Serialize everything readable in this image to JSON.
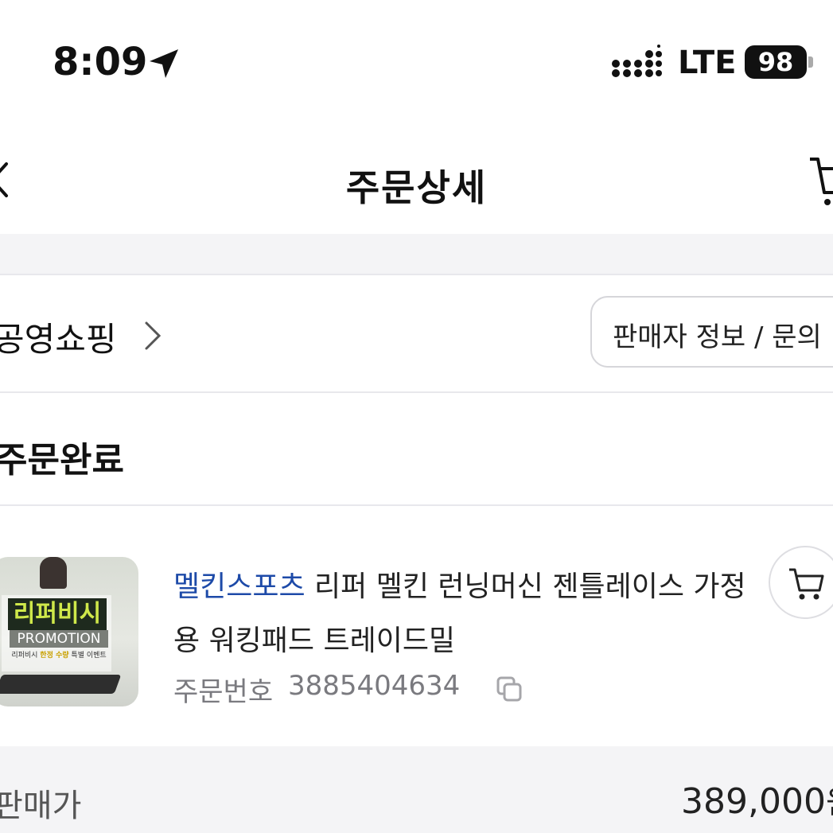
{
  "status_bar": {
    "time": "8:09",
    "network": "LTE",
    "battery": "98"
  },
  "header": {
    "title": "주문상세"
  },
  "seller": {
    "name": "공영쇼핑",
    "info_button": "판매자 정보 / 문의"
  },
  "order": {
    "status": "주문완료",
    "product": {
      "brand": "멜킨스포츠",
      "name": " 리퍼 멜킨 런닝머신 젠틀레이스 가정용 워킹패드 트레이드밀",
      "thumbnail": {
        "title": "리퍼비시",
        "promo": "PROMOTION",
        "sub_prefix": "리퍼비시 ",
        "sub_highlight": "한정 수량",
        "sub_suffix": " 특별 이벤트"
      }
    },
    "order_number_label": "주문번호",
    "order_number": "3885404634"
  },
  "price": {
    "label": "판매가",
    "value": "389,000",
    "unit": "원"
  },
  "icons": {
    "back": "chevron-left-icon",
    "cart": "cart-icon",
    "copy": "copy-icon",
    "location": "location-arrow-icon",
    "signal": "signal-icon",
    "seller_chevron": "chevron-right-icon"
  },
  "colors": {
    "brand_text": "#1d4aa8",
    "band_gray": "#f4f4f6"
  }
}
